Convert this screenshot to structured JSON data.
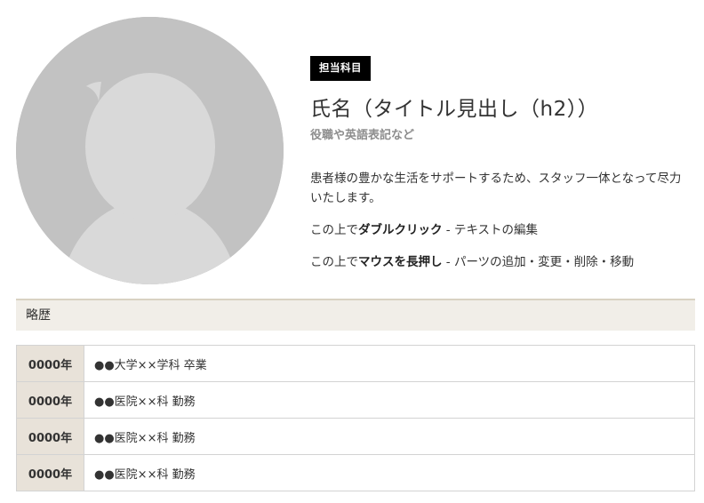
{
  "profile": {
    "subject_badge": "担当科目",
    "name": "氏名（タイトル見出し（h2））",
    "role": "役職や英語表記など",
    "description": "患者様の豊かな生活をサポートするため、スタッフ一体となって尽力いたします。",
    "hint1": {
      "prefix": "この上で",
      "strong": "ダブルクリック",
      "suffix": " - テキストの編集"
    },
    "hint2": {
      "prefix": "この上で",
      "strong": "マウスを長押し",
      "suffix": " - パーツの追加・変更・削除・移動"
    },
    "avatar_icon": "person-placeholder-icon"
  },
  "history": {
    "title": "略歴",
    "rows": [
      {
        "year": "0000年",
        "text": "●●大学××学科 卒業"
      },
      {
        "year": "0000年",
        "text": "●●医院××科 勤務"
      },
      {
        "year": "0000年",
        "text": "●●医院××科 勤務"
      },
      {
        "year": "0000年",
        "text": "●●医院××科 勤務"
      }
    ]
  },
  "colors": {
    "badge_bg": "#000000",
    "avatar_bg": "#c2c2c2",
    "avatar_figure": "#d9d9d9",
    "header_bg": "#f1eee8",
    "header_border": "#d9d2c2",
    "year_cell_bg": "#e8e2d9"
  }
}
